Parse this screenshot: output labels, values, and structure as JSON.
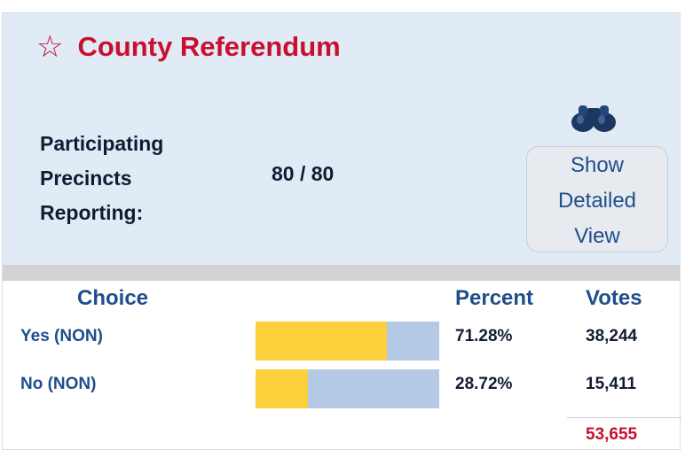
{
  "header": {
    "star_icon": "☆",
    "title": "County Referendum",
    "precincts_label_lines": [
      "Participating",
      "Precincts",
      "Reporting:"
    ],
    "precincts_value": "80 / 80",
    "detail_button_lines": [
      "Show",
      "Detailed",
      "View"
    ],
    "detail_icon": "binoculars-icon"
  },
  "table": {
    "headers": {
      "choice": "Choice",
      "percent": "Percent",
      "votes": "Votes"
    },
    "rows": [
      {
        "choice": "Yes (NON)",
        "percent": "71.28%",
        "votes": "38,244",
        "share": 0.7128
      },
      {
        "choice": "No (NON)",
        "percent": "28.72%",
        "votes": "15,411",
        "share": 0.2872
      }
    ],
    "total_votes": "53,655"
  },
  "colors": {
    "title_red": "#c8102e",
    "header_bg": "#e1ebf6",
    "link_blue": "#1f4e8c",
    "bar_fill": "#fbd03a",
    "bar_track": "#b4c9e6"
  }
}
